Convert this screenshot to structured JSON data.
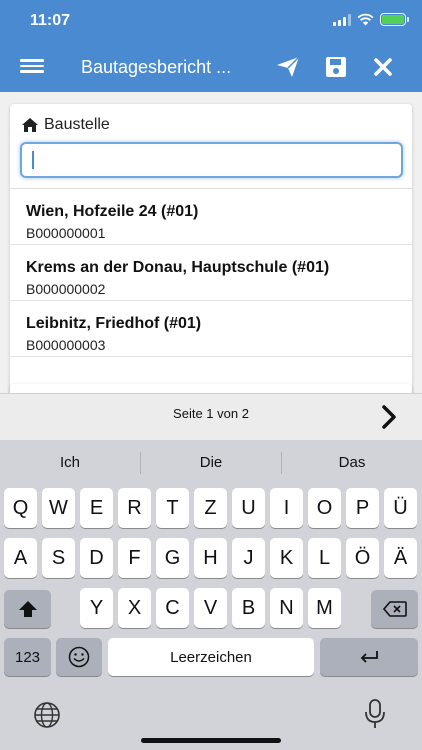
{
  "status": {
    "time": "11:07"
  },
  "header": {
    "title": "Bautagesbericht ..."
  },
  "form": {
    "field_label": "Baustelle",
    "search_value": "",
    "results": [
      {
        "name": "Wien, Hofzeile 24 (#01)",
        "code": "B000000001"
      },
      {
        "name": "Krems an der Donau, Hauptschule (#01)",
        "code": "B000000002"
      },
      {
        "name": "Leibnitz, Friedhof (#01)",
        "code": "B000000003"
      }
    ]
  },
  "pager": {
    "label": "Seite 1 von 2"
  },
  "keyboard": {
    "suggestions": [
      "Ich",
      "Die",
      "Das"
    ],
    "row1": [
      "Q",
      "W",
      "E",
      "R",
      "T",
      "Z",
      "U",
      "I",
      "O",
      "P",
      "Ü"
    ],
    "row2": [
      "A",
      "S",
      "D",
      "F",
      "G",
      "H",
      "J",
      "K",
      "L",
      "Ö",
      "Ä"
    ],
    "row3": [
      "Y",
      "X",
      "C",
      "V",
      "B",
      "N",
      "M"
    ],
    "numbers_label": "123",
    "space_label": "Leerzeichen"
  },
  "colors": {
    "accent": "#4a8ad0",
    "battery": "#52d05a"
  }
}
